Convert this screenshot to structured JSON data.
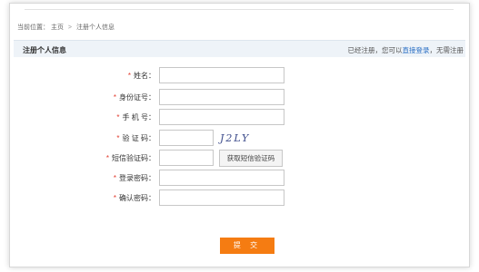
{
  "breadcrumb": {
    "prefix": "当前位置：",
    "home": "主页",
    "separator": ">",
    "current": "注册个人信息"
  },
  "header": {
    "title": "注册个人信息",
    "right_text_before": "已经注册，您可以",
    "login_link": "直接登录",
    "right_text_after": "，无需注册"
  },
  "form": {
    "required_mark": "*",
    "fields": [
      {
        "label": "姓名：",
        "value": ""
      },
      {
        "label": "身份证号：",
        "value": ""
      },
      {
        "label": "手 机 号：",
        "value": ""
      },
      {
        "label": "验 证 码：",
        "value": ""
      },
      {
        "label": "短信验证码：",
        "value": ""
      },
      {
        "label": "登录密码：",
        "value": ""
      },
      {
        "label": "确认密码：",
        "value": ""
      }
    ],
    "captcha_text": "J2LY",
    "sms_button": "获取短信验证码",
    "submit_button": "提 交"
  },
  "colors": {
    "required": "#e23b2e",
    "link": "#2a6fc4",
    "submit": "#f57c12",
    "header_bg": "#eef3f8"
  }
}
